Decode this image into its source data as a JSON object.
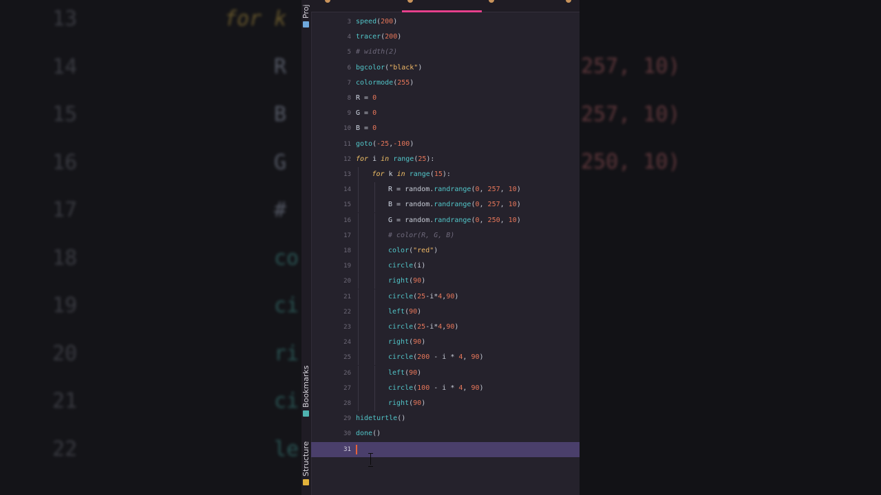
{
  "tool_windows": {
    "project": "Proj",
    "bookmarks": "Bookmarks",
    "structure": "Structure"
  },
  "colors": {
    "editor_bg": "#25222c",
    "current_line": "#4a3f6b",
    "active_tab_underline": "#e6408c",
    "function": "#52c6c9",
    "number": "#e8775a",
    "string": "#f0b866",
    "keyword": "#f2c166",
    "comment": "#6f6a7c"
  },
  "icons": {
    "project_icon": "folder-icon",
    "bookmarks_icon": "bookmark-icon",
    "structure_icon": "structure-icon"
  },
  "editor": {
    "current_line": 31,
    "lines": [
      {
        "num": "3",
        "tokens": [
          {
            "t": "speed",
            "c": "fn"
          },
          {
            "t": "(",
            "c": "op"
          },
          {
            "t": "200",
            "c": "num"
          },
          {
            "t": ")",
            "c": "op"
          }
        ]
      },
      {
        "num": "4",
        "tokens": [
          {
            "t": "tracer",
            "c": "fn"
          },
          {
            "t": "(",
            "c": "op"
          },
          {
            "t": "200",
            "c": "num"
          },
          {
            "t": ")",
            "c": "op"
          }
        ]
      },
      {
        "num": "5",
        "tokens": [
          {
            "t": "# width(2)",
            "c": "cm"
          }
        ]
      },
      {
        "num": "6",
        "tokens": [
          {
            "t": "bgcolor",
            "c": "fn"
          },
          {
            "t": "(",
            "c": "op"
          },
          {
            "t": "\"black\"",
            "c": "str"
          },
          {
            "t": ")",
            "c": "op"
          }
        ]
      },
      {
        "num": "7",
        "tokens": [
          {
            "t": "colormode",
            "c": "fn"
          },
          {
            "t": "(",
            "c": "op"
          },
          {
            "t": "255",
            "c": "num"
          },
          {
            "t": ")",
            "c": "op"
          }
        ]
      },
      {
        "num": "8",
        "tokens": [
          {
            "t": "R",
            "c": "id"
          },
          {
            "t": " = ",
            "c": "op"
          },
          {
            "t": "0",
            "c": "num"
          }
        ]
      },
      {
        "num": "9",
        "tokens": [
          {
            "t": "G",
            "c": "id"
          },
          {
            "t": " = ",
            "c": "op"
          },
          {
            "t": "0",
            "c": "num"
          }
        ]
      },
      {
        "num": "10",
        "tokens": [
          {
            "t": "B",
            "c": "id"
          },
          {
            "t": " = ",
            "c": "op"
          },
          {
            "t": "0",
            "c": "num"
          }
        ]
      },
      {
        "num": "11",
        "tokens": [
          {
            "t": "goto",
            "c": "fn"
          },
          {
            "t": "(",
            "c": "op"
          },
          {
            "t": "-25",
            "c": "num"
          },
          {
            "t": ",",
            "c": "op"
          },
          {
            "t": "-100",
            "c": "num"
          },
          {
            "t": ")",
            "c": "op"
          }
        ]
      },
      {
        "num": "12",
        "tokens": [
          {
            "t": "for",
            "c": "kw"
          },
          {
            "t": " i ",
            "c": "id"
          },
          {
            "t": "in",
            "c": "kw"
          },
          {
            "t": " ",
            "c": "op"
          },
          {
            "t": "range",
            "c": "fn"
          },
          {
            "t": "(",
            "c": "op"
          },
          {
            "t": "25",
            "c": "num"
          },
          {
            "t": "):",
            "c": "op"
          }
        ]
      },
      {
        "num": "13",
        "indent": 1,
        "tokens": [
          {
            "t": "for",
            "c": "kw"
          },
          {
            "t": " k ",
            "c": "id"
          },
          {
            "t": "in",
            "c": "kw"
          },
          {
            "t": " ",
            "c": "op"
          },
          {
            "t": "range",
            "c": "fn"
          },
          {
            "t": "(",
            "c": "op"
          },
          {
            "t": "15",
            "c": "num"
          },
          {
            "t": "):",
            "c": "op"
          }
        ]
      },
      {
        "num": "14",
        "indent": 2,
        "tokens": [
          {
            "t": "R",
            "c": "id"
          },
          {
            "t": " = random.",
            "c": "op"
          },
          {
            "t": "randrange",
            "c": "fn"
          },
          {
            "t": "(",
            "c": "op"
          },
          {
            "t": "0",
            "c": "num"
          },
          {
            "t": ", ",
            "c": "op"
          },
          {
            "t": "257",
            "c": "num"
          },
          {
            "t": ", ",
            "c": "op"
          },
          {
            "t": "10",
            "c": "num"
          },
          {
            "t": ")",
            "c": "op"
          }
        ]
      },
      {
        "num": "15",
        "indent": 2,
        "tokens": [
          {
            "t": "B",
            "c": "id"
          },
          {
            "t": " = random.",
            "c": "op"
          },
          {
            "t": "randrange",
            "c": "fn"
          },
          {
            "t": "(",
            "c": "op"
          },
          {
            "t": "0",
            "c": "num"
          },
          {
            "t": ", ",
            "c": "op"
          },
          {
            "t": "257",
            "c": "num"
          },
          {
            "t": ", ",
            "c": "op"
          },
          {
            "t": "10",
            "c": "num"
          },
          {
            "t": ")",
            "c": "op"
          }
        ]
      },
      {
        "num": "16",
        "indent": 2,
        "tokens": [
          {
            "t": "G",
            "c": "id"
          },
          {
            "t": " = random.",
            "c": "op"
          },
          {
            "t": "randrange",
            "c": "fn"
          },
          {
            "t": "(",
            "c": "op"
          },
          {
            "t": "0",
            "c": "num"
          },
          {
            "t": ", ",
            "c": "op"
          },
          {
            "t": "250",
            "c": "num"
          },
          {
            "t": ", ",
            "c": "op"
          },
          {
            "t": "10",
            "c": "num"
          },
          {
            "t": ")",
            "c": "op"
          }
        ]
      },
      {
        "num": "17",
        "indent": 2,
        "tokens": [
          {
            "t": "# color(R, G, B)",
            "c": "cm"
          }
        ]
      },
      {
        "num": "18",
        "indent": 2,
        "tokens": [
          {
            "t": "color",
            "c": "fn"
          },
          {
            "t": "(",
            "c": "op"
          },
          {
            "t": "\"red\"",
            "c": "str"
          },
          {
            "t": ")",
            "c": "op"
          }
        ]
      },
      {
        "num": "19",
        "indent": 2,
        "tokens": [
          {
            "t": "circle",
            "c": "fn"
          },
          {
            "t": "(",
            "c": "op"
          },
          {
            "t": "i",
            "c": "id"
          },
          {
            "t": ")",
            "c": "op"
          }
        ]
      },
      {
        "num": "20",
        "indent": 2,
        "tokens": [
          {
            "t": "right",
            "c": "fn"
          },
          {
            "t": "(",
            "c": "op"
          },
          {
            "t": "90",
            "c": "num"
          },
          {
            "t": ")",
            "c": "op"
          }
        ]
      },
      {
        "num": "21",
        "indent": 2,
        "tokens": [
          {
            "t": "circle",
            "c": "fn"
          },
          {
            "t": "(",
            "c": "op"
          },
          {
            "t": "25",
            "c": "num"
          },
          {
            "t": "-i*",
            "c": "op"
          },
          {
            "t": "4",
            "c": "num"
          },
          {
            "t": ",",
            "c": "op"
          },
          {
            "t": "90",
            "c": "num"
          },
          {
            "t": ")",
            "c": "op"
          }
        ]
      },
      {
        "num": "22",
        "indent": 2,
        "tokens": [
          {
            "t": "left",
            "c": "fn"
          },
          {
            "t": "(",
            "c": "op"
          },
          {
            "t": "90",
            "c": "num"
          },
          {
            "t": ")",
            "c": "op"
          }
        ]
      },
      {
        "num": "23",
        "indent": 2,
        "tokens": [
          {
            "t": "circle",
            "c": "fn"
          },
          {
            "t": "(",
            "c": "op"
          },
          {
            "t": "25",
            "c": "num"
          },
          {
            "t": "-i*",
            "c": "op"
          },
          {
            "t": "4",
            "c": "num"
          },
          {
            "t": ",",
            "c": "op"
          },
          {
            "t": "90",
            "c": "num"
          },
          {
            "t": ")",
            "c": "op"
          }
        ]
      },
      {
        "num": "24",
        "indent": 2,
        "tokens": [
          {
            "t": "right",
            "c": "fn"
          },
          {
            "t": "(",
            "c": "op"
          },
          {
            "t": "90",
            "c": "num"
          },
          {
            "t": ")",
            "c": "op"
          }
        ]
      },
      {
        "num": "25",
        "indent": 2,
        "tokens": [
          {
            "t": "circle",
            "c": "fn"
          },
          {
            "t": "(",
            "c": "op"
          },
          {
            "t": "200",
            "c": "num"
          },
          {
            "t": " - i * ",
            "c": "op"
          },
          {
            "t": "4",
            "c": "num"
          },
          {
            "t": ", ",
            "c": "op"
          },
          {
            "t": "90",
            "c": "num"
          },
          {
            "t": ")",
            "c": "op"
          }
        ]
      },
      {
        "num": "26",
        "indent": 2,
        "tokens": [
          {
            "t": "left",
            "c": "fn"
          },
          {
            "t": "(",
            "c": "op"
          },
          {
            "t": "90",
            "c": "num"
          },
          {
            "t": ")",
            "c": "op"
          }
        ]
      },
      {
        "num": "27",
        "indent": 2,
        "tokens": [
          {
            "t": "circle",
            "c": "fn"
          },
          {
            "t": "(",
            "c": "op"
          },
          {
            "t": "100",
            "c": "num"
          },
          {
            "t": " - i * ",
            "c": "op"
          },
          {
            "t": "4",
            "c": "num"
          },
          {
            "t": ", ",
            "c": "op"
          },
          {
            "t": "90",
            "c": "num"
          },
          {
            "t": ")",
            "c": "op"
          }
        ]
      },
      {
        "num": "28",
        "indent": 2,
        "tokens": [
          {
            "t": "right",
            "c": "fn"
          },
          {
            "t": "(",
            "c": "op"
          },
          {
            "t": "90",
            "c": "num"
          },
          {
            "t": ")",
            "c": "op"
          }
        ]
      },
      {
        "num": "29",
        "tokens": [
          {
            "t": "hideturtle",
            "c": "fn"
          },
          {
            "t": "()",
            "c": "op"
          }
        ]
      },
      {
        "num": "30",
        "tokens": [
          {
            "t": "done",
            "c": "fn"
          },
          {
            "t": "()",
            "c": "op"
          }
        ]
      },
      {
        "num": "31",
        "tokens": []
      }
    ]
  },
  "backdrop_left": {
    "numbers": [
      "13",
      "14",
      "15",
      "16",
      "17",
      "18",
      "19",
      "20",
      "21",
      "22"
    ],
    "code": [
      {
        "t": "for k",
        "c": "kw"
      },
      {
        "t": "R",
        "c": "code"
      },
      {
        "t": "B",
        "c": "code"
      },
      {
        "t": "G",
        "c": "code"
      },
      {
        "t": "#",
        "c": "code"
      },
      {
        "t": "co",
        "c": "teal"
      },
      {
        "t": "ci",
        "c": "teal"
      },
      {
        "t": "ri",
        "c": "teal"
      },
      {
        "t": "ci",
        "c": "teal"
      },
      {
        "t": "le",
        "c": "teal"
      }
    ]
  },
  "backdrop_right": {
    "values": [
      "257, 10)",
      "257, 10)",
      "250, 10)"
    ]
  }
}
